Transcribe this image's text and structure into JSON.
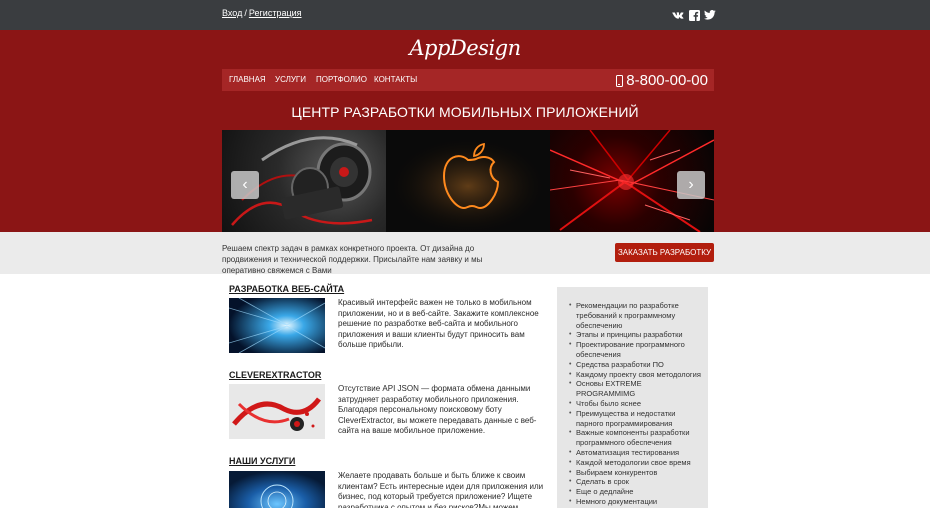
{
  "topbar": {
    "login": "Вход",
    "separator": "/",
    "register": "Регистрация",
    "social": [
      {
        "name": "vk-icon",
        "glyph": "vk"
      },
      {
        "name": "facebook-icon",
        "glyph": "f"
      },
      {
        "name": "twitter-icon",
        "glyph": "t"
      }
    ]
  },
  "header": {
    "logo": "AppDesign",
    "nav": [
      "ГЛАВНАЯ",
      "УСЛУГИ",
      "ПОРТФОЛИО",
      "КОНТАКТЫ"
    ],
    "phone": "8-800-00-00",
    "title": "ЦЕНТР РАЗРАБОТКИ МОБИЛЬНЫХ ПРИЛОЖЕНИЙ"
  },
  "slider": {
    "prev": "‹",
    "next": "›"
  },
  "band": {
    "text": "Решаем спектр задач в рамках конкретного проекта. От дизайна до продвижения и технической поддержки. Присылайте нам заявку и мы оперативно свяжемся с Вами",
    "button": "ЗАКАЗАТЬ РАЗРАБОТКУ"
  },
  "sections": [
    {
      "title": "РАЗРАБОТКА ВЕБ-САЙТА",
      "text": "Красивый интерфейс важен не только в мобильном приложении, но и в веб-сайте. Закажите комплексное решение по разработке веб-сайта и мобильного приложения и ваши клиенты будут приносить вам больше прибыли."
    },
    {
      "title": "CLEVEREXTRACTOR",
      "text": "Отсутствие API JSON — формата обмена данными затрудняет разработку мобильного приложения. Благодаря персональному поисковому боту CleverExtractor, вы можете передавать данные с веб-сайта на ваше мобильное приложение."
    },
    {
      "title": "НАШИ УСЛУГИ",
      "text": "Желаете продавать больше и быть ближе к своим клиентам? Есть интересные идеи для приложения или бизнес, под который требуется приложение? Ищете разработчика с опытом и без рисков?Мы можем предложить вам услуги по"
    }
  ],
  "sidebar": {
    "items": [
      "Рекомендации по разработке требований к программному обеспечению",
      "Этапы и принципы разработки",
      "Проектирование программного обеспечения",
      "Средства разработки ПО",
      "Каждому проекту своя методология",
      "Основы EXTREME PROGRAMMIMG",
      "Чтобы было яснее",
      "Преимущества и недостатки парного программирования",
      "Важные компоненты разработки программного обеспечения",
      "Автоматизация тестирования",
      "Каждой методологии свое время",
      "Выбираем конкурентов",
      "Сделать в срок",
      "Еще о дедлайне",
      "Немного документации"
    ]
  },
  "colors": {
    "header_bg": "#8b1515",
    "nav_bg": "#a52626",
    "topbar_bg": "#3a3d40",
    "button_bg": "#b21e0e",
    "band_bg": "#ebebeb",
    "sidebar_bg": "#e6e6e6"
  }
}
